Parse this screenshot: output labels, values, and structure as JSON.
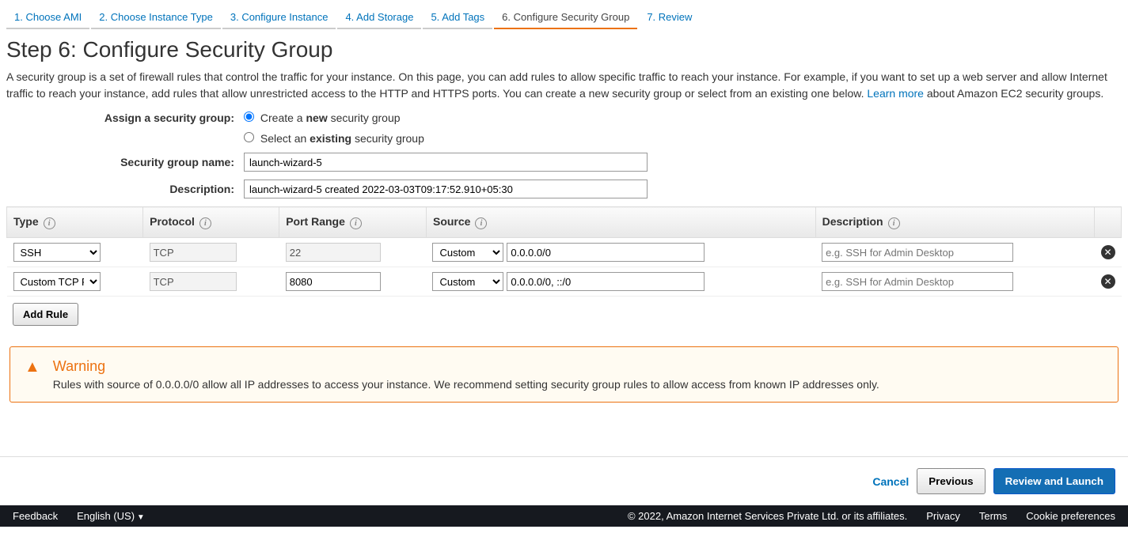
{
  "tabs": [
    {
      "label": "1. Choose AMI"
    },
    {
      "label": "2. Choose Instance Type"
    },
    {
      "label": "3. Configure Instance"
    },
    {
      "label": "4. Add Storage"
    },
    {
      "label": "5. Add Tags"
    },
    {
      "label": "6. Configure Security Group"
    },
    {
      "label": "7. Review"
    }
  ],
  "heading": "Step 6: Configure Security Group",
  "description": "A security group is a set of firewall rules that control the traffic for your instance. On this page, you can add rules to allow specific traffic to reach your instance. For example, if you want to set up a web server and allow Internet traffic to reach your instance, add rules that allow unrestricted access to the HTTP and HTTPS ports. You can create a new security group or select from an existing one below. ",
  "learn_more": "Learn more",
  "description_tail": " about Amazon EC2 security groups.",
  "form": {
    "assign_label": "Assign a security group:",
    "radio_create_pre": "Create a ",
    "radio_create_bold": "new",
    "radio_create_post": " security group",
    "radio_select_pre": "Select an ",
    "radio_select_bold": "existing",
    "radio_select_post": " security group",
    "name_label": "Security group name:",
    "name_value": "launch-wizard-5",
    "desc_label": "Description:",
    "desc_value": "launch-wizard-5 created 2022-03-03T09:17:52.910+05:30"
  },
  "table": {
    "headers": {
      "type": "Type",
      "protocol": "Protocol",
      "port": "Port Range",
      "source": "Source",
      "desc": "Description"
    },
    "rows": [
      {
        "type": "SSH",
        "protocol": "TCP",
        "port": "22",
        "source": "Custom",
        "cidr": "0.0.0.0/0",
        "desc_ph": "e.g. SSH for Admin Desktop"
      },
      {
        "type": "Custom TCP R",
        "protocol": "TCP",
        "port": "8080",
        "source": "Custom",
        "cidr": "0.0.0.0/0, ::/0",
        "desc_ph": "e.g. SSH for Admin Desktop"
      }
    ],
    "add_rule": "Add Rule"
  },
  "warning": {
    "title": "Warning",
    "text": "Rules with source of 0.0.0.0/0 allow all IP addresses to access your instance. We recommend setting security group rules to allow access from known IP addresses only."
  },
  "actions": {
    "cancel": "Cancel",
    "previous": "Previous",
    "launch": "Review and Launch"
  },
  "footer": {
    "feedback": "Feedback",
    "lang": "English (US)",
    "copy": "© 2022, Amazon Internet Services Private Ltd. or its affiliates.",
    "privacy": "Privacy",
    "terms": "Terms",
    "cookie": "Cookie preferences"
  }
}
